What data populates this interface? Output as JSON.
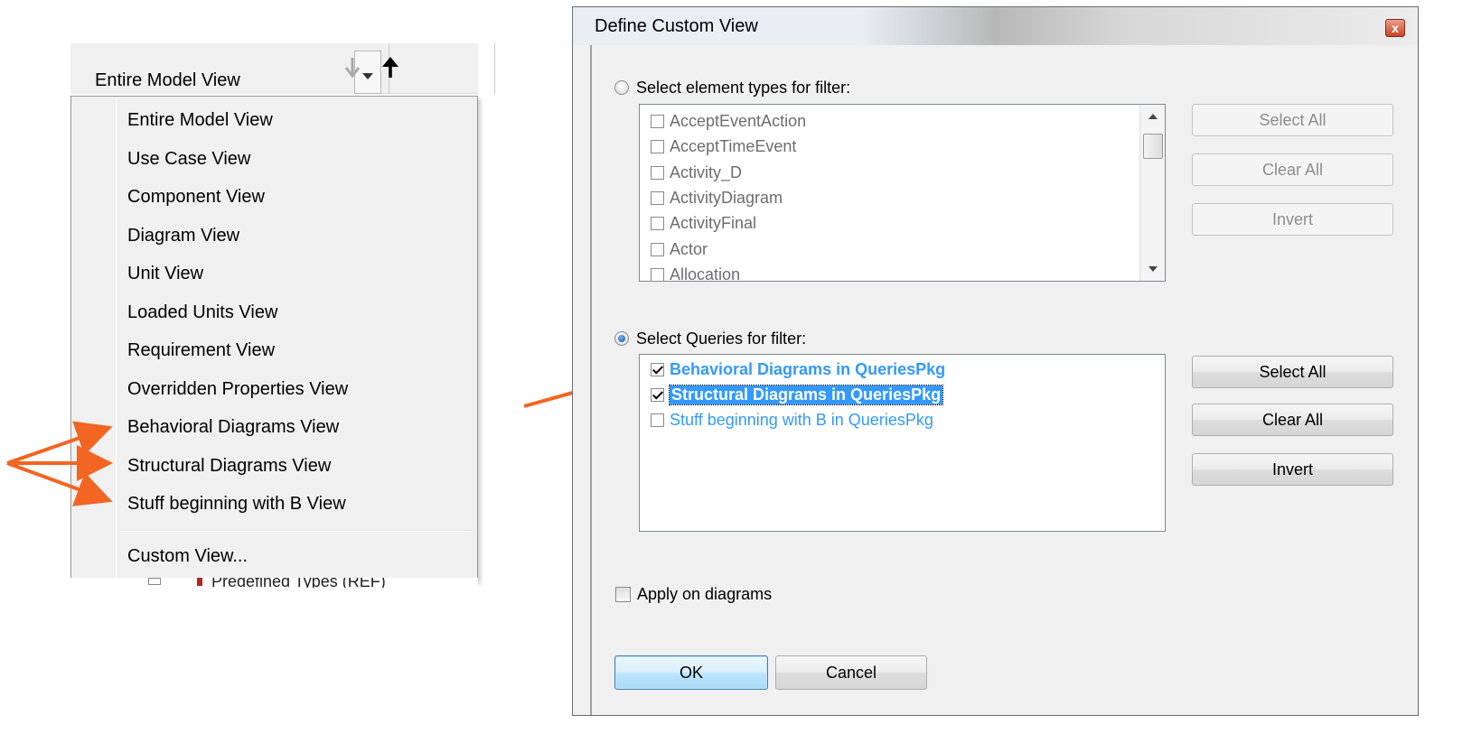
{
  "toolbar": {
    "combo_value": "Entire Model View",
    "back_icon": "arrow-down-disabled-icon",
    "up_icon": "arrow-up-icon"
  },
  "menu": {
    "items": [
      "Entire Model View",
      "Use Case View",
      "Component View",
      "Diagram View",
      "Unit View",
      "Loaded Units View",
      "Requirement View",
      "Overridden Properties View",
      "Behavioral Diagrams View",
      "Structural Diagrams View",
      "Stuff beginning with B View"
    ],
    "custom_item": "Custom View...",
    "below_text": "Predefined Types (REF)"
  },
  "annotation_color": "#f26522",
  "dialog": {
    "title": "Define Custom View",
    "close_label": "x",
    "element_types": {
      "label": "Select element types for filter:",
      "selected": false,
      "items": [
        "AcceptEventAction",
        "AcceptTimeEvent",
        "Activity_D",
        "ActivityDiagram",
        "ActivityFinal",
        "Actor",
        "Allocation"
      ],
      "select_all": "Select All",
      "clear_all": "Clear All",
      "invert": "Invert"
    },
    "queries": {
      "label": "Select Queries for filter:",
      "selected": true,
      "items": [
        "Behavioral Diagrams in QueriesPkg",
        "Structural Diagrams in QueriesPkg",
        "Stuff beginning with B in QueriesPkg"
      ],
      "select_all": "Select All",
      "clear_all": "Clear All",
      "invert": "Invert"
    },
    "apply_on_diagrams": "Apply on diagrams",
    "ok": "OK",
    "cancel": "Cancel"
  }
}
